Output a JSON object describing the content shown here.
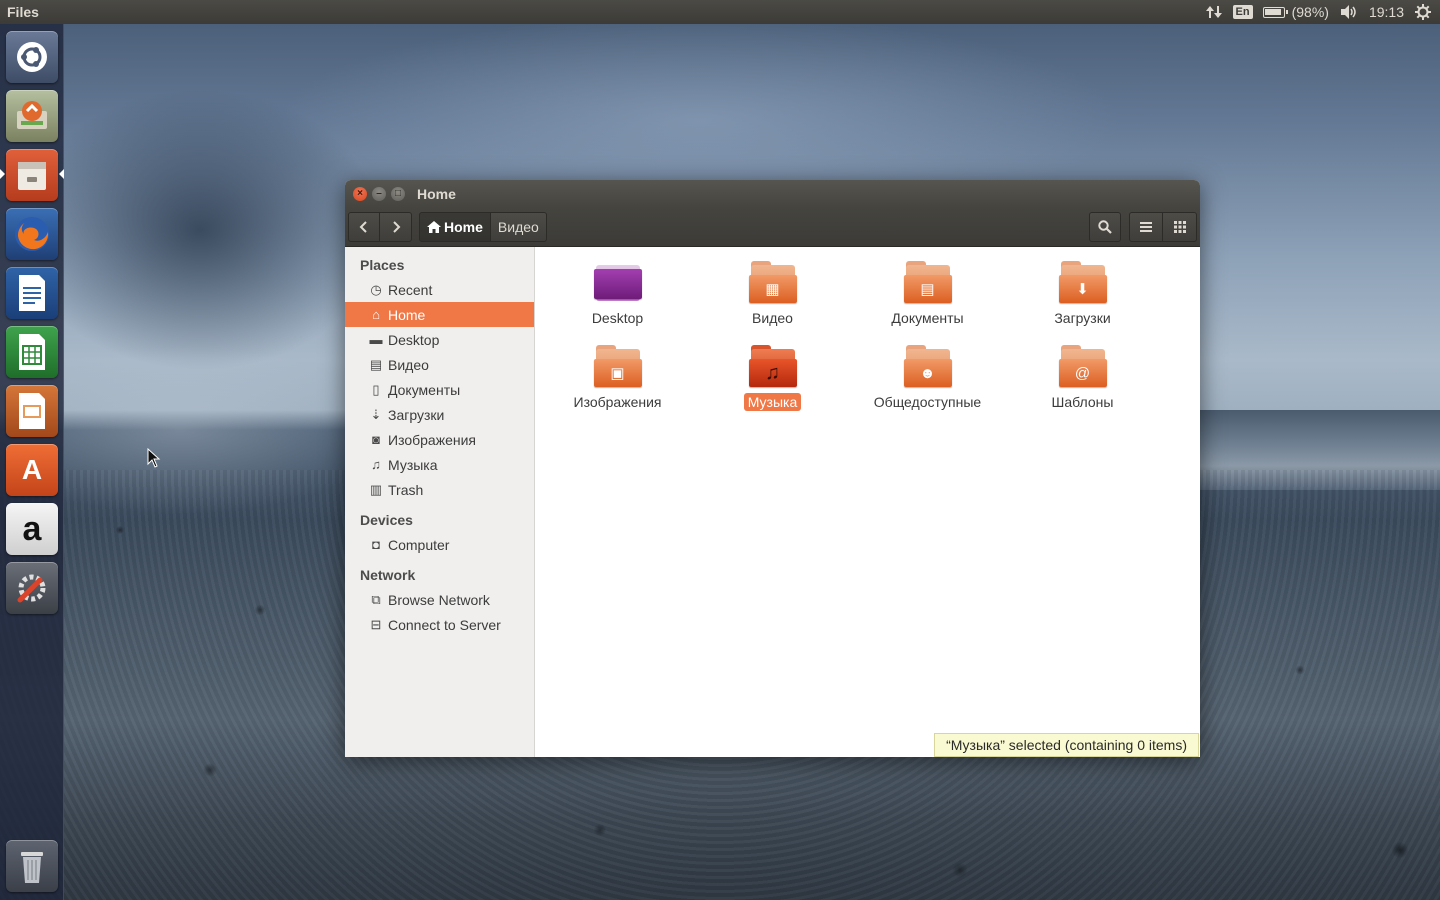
{
  "top_panel": {
    "app_title": "Files",
    "keyboard_layout": "En",
    "battery_text": "(98%)",
    "clock": "19:13",
    "icons": [
      "network-updown-icon",
      "battery-icon",
      "volume-icon",
      "settings-gear-icon"
    ]
  },
  "launcher": {
    "items": [
      {
        "name": "dash-home",
        "icon": "ubuntu-logo-icon"
      },
      {
        "name": "software-updater",
        "icon": "updater-icon"
      },
      {
        "name": "files",
        "icon": "file-cabinet-icon",
        "active": true
      },
      {
        "name": "firefox",
        "icon": "firefox-icon"
      },
      {
        "name": "libreoffice-writer",
        "icon": "writer-icon"
      },
      {
        "name": "libreoffice-calc",
        "icon": "calc-icon"
      },
      {
        "name": "libreoffice-impress",
        "icon": "impress-icon"
      },
      {
        "name": "ubuntu-software-center",
        "icon": "shopping-bag-icon"
      },
      {
        "name": "amazon",
        "icon": "amazon-icon"
      },
      {
        "name": "system-settings",
        "icon": "wrench-icon"
      },
      {
        "name": "trash",
        "icon": "trash-can-icon"
      }
    ],
    "glyphs": {
      "amazon": "a",
      "software-center": "A"
    }
  },
  "window": {
    "title": "Home",
    "breadcrumbs": [
      "Home",
      "Видео"
    ],
    "sidebar": {
      "places_header": "Places",
      "places": [
        {
          "label": "Recent",
          "icon": "clock-icon"
        },
        {
          "label": "Home",
          "icon": "home-icon",
          "selected": true
        },
        {
          "label": "Desktop",
          "icon": "desktop-folder-icon"
        },
        {
          "label": "Видео",
          "icon": "film-icon"
        },
        {
          "label": "Документы",
          "icon": "document-icon"
        },
        {
          "label": "Загрузки",
          "icon": "download-icon"
        },
        {
          "label": "Изображения",
          "icon": "camera-icon"
        },
        {
          "label": "Музыка",
          "icon": "music-note-icon"
        },
        {
          "label": "Trash",
          "icon": "trash-icon"
        }
      ],
      "devices_header": "Devices",
      "devices": [
        {
          "label": "Computer",
          "icon": "drive-icon"
        }
      ],
      "network_header": "Network",
      "network": [
        {
          "label": "Browse Network",
          "icon": "network-icon"
        },
        {
          "label": "Connect to Server",
          "icon": "server-icon"
        }
      ]
    },
    "files": [
      {
        "label": "Desktop",
        "icon": "desktop-folder-icon"
      },
      {
        "label": "Видео",
        "icon": "video-folder-icon"
      },
      {
        "label": "Документы",
        "icon": "documents-folder-icon"
      },
      {
        "label": "Загрузки",
        "icon": "downloads-folder-icon"
      },
      {
        "label": "Изображения",
        "icon": "pictures-folder-icon"
      },
      {
        "label": "Музыка",
        "icon": "music-folder-icon",
        "selected": true
      },
      {
        "label": "Общедоступные",
        "icon": "public-folder-icon"
      },
      {
        "label": "Шаблоны",
        "icon": "templates-folder-icon"
      }
    ],
    "status": "“Музыка” selected  (containing 0 items)"
  },
  "colors": {
    "accent": "#f07746",
    "panel": "#3c3b37",
    "panel_text": "#dfdbd2"
  }
}
